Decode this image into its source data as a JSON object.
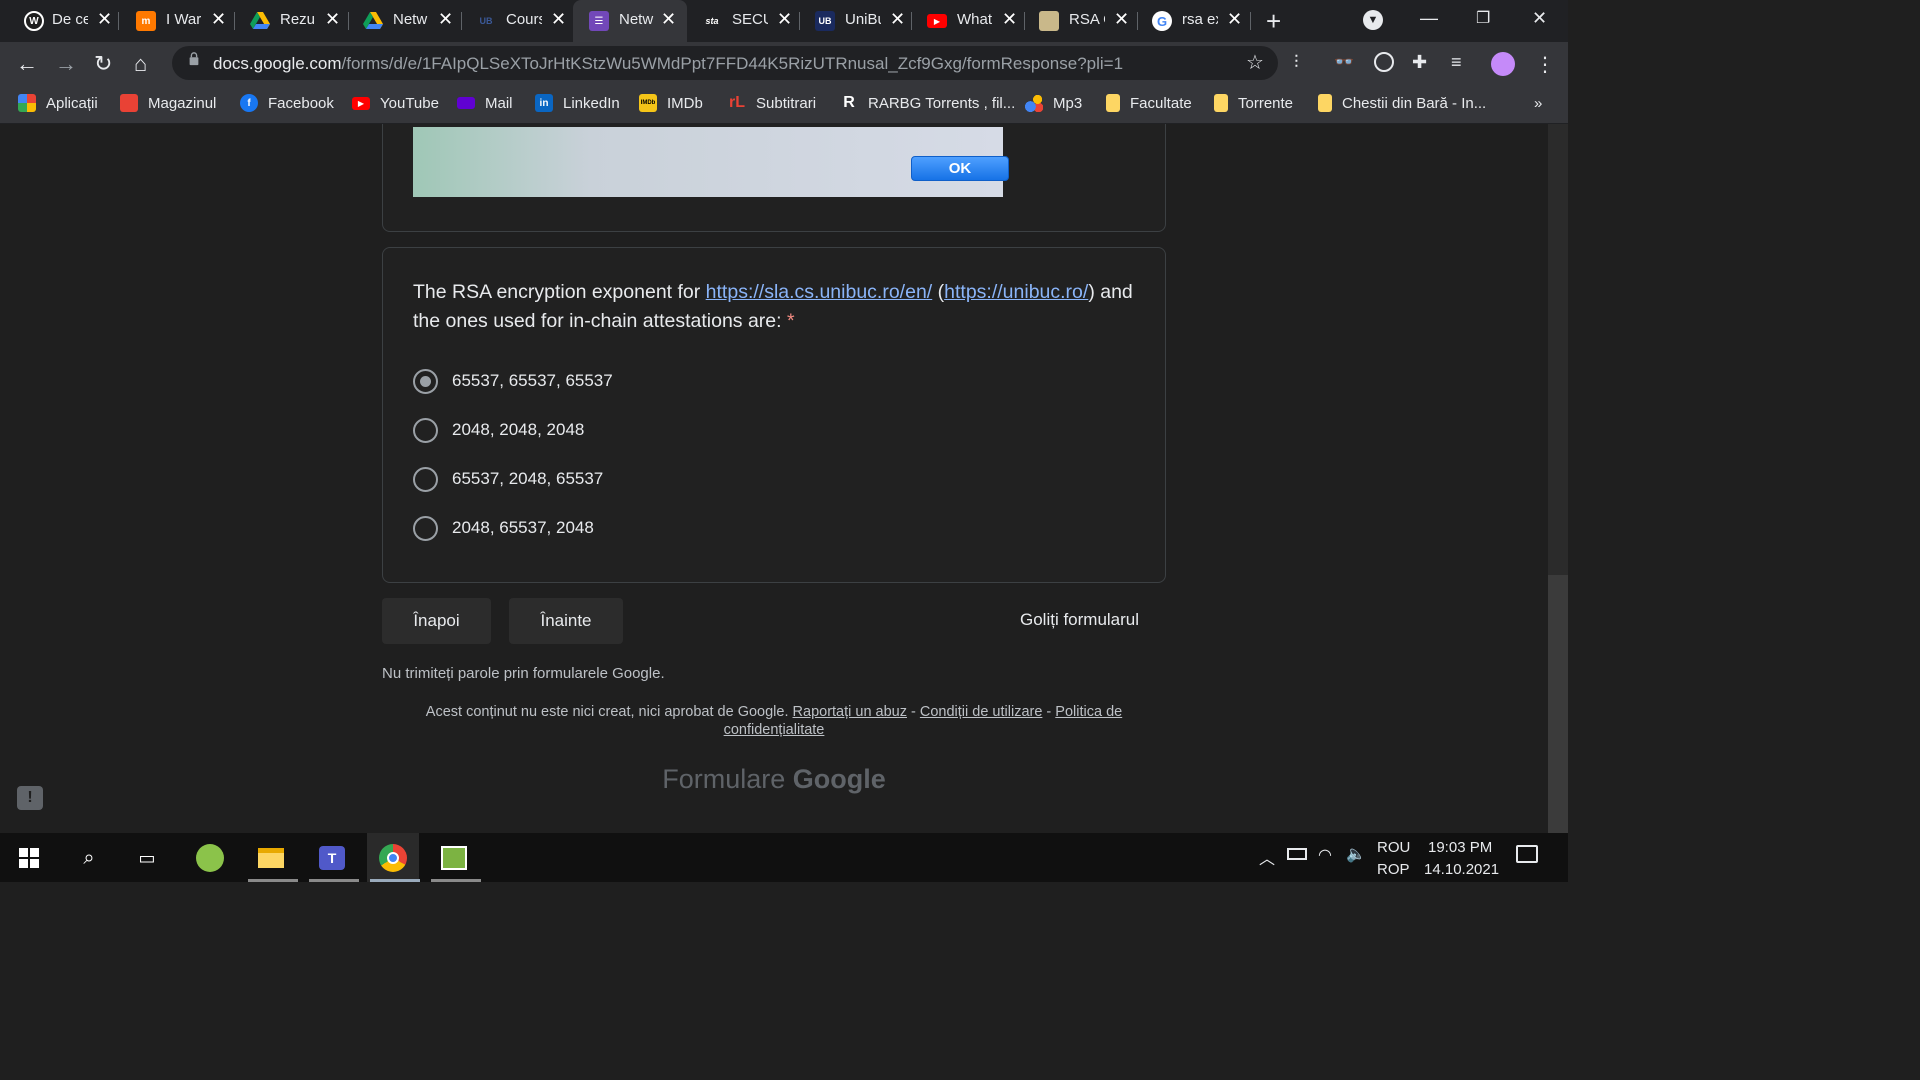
{
  "tabs": [
    {
      "title": "De ce",
      "icon": "wordpress-icon"
    },
    {
      "title": "I War",
      "icon": "orange-m-icon"
    },
    {
      "title": "Rezul",
      "icon": "google-drive-icon"
    },
    {
      "title": "Netw",
      "icon": "google-drive-icon"
    },
    {
      "title": "Cours",
      "icon": "ub-icon"
    },
    {
      "title": "Netw",
      "icon": "google-forms-icon"
    },
    {
      "title": "SECU",
      "icon": "sta-icon"
    },
    {
      "title": "UniBu",
      "icon": "ub-icon"
    },
    {
      "title": "What",
      "icon": "youtube-icon"
    },
    {
      "title": "RSA C",
      "icon": "rsa-icon"
    },
    {
      "title": "rsa ex",
      "icon": "google-icon"
    }
  ],
  "toolbar": {
    "url_host": "docs.google.com",
    "url_path": "/forms/d/e/1FAIpQLSeXToJrHtKStzWu5WMdPpt7FFD44K5RizUTRnusal_Zcf9Gxg/formResponse?pli=1"
  },
  "bookmarks": [
    {
      "label": "Aplicații",
      "icon": "apps-grid-icon",
      "color": "#e94235"
    },
    {
      "label": "Magazinul",
      "icon": "store-icon",
      "color": "#e94235"
    },
    {
      "label": "Facebook",
      "icon": "facebook-icon",
      "color": "#1877f2"
    },
    {
      "label": "YouTube",
      "icon": "youtube-icon",
      "color": "#ff0000"
    },
    {
      "label": "Mail",
      "icon": "mail-icon",
      "color": "#6001d2"
    },
    {
      "label": "LinkedIn",
      "icon": "linkedin-icon",
      "color": "#0a66c2"
    },
    {
      "label": "IMDb",
      "icon": "imdb-icon",
      "color": "#f5c518"
    },
    {
      "label": "Subtitrari",
      "icon": "subtitrari-icon",
      "color": "#e94235"
    },
    {
      "label": "RARBG Torrents , fil...",
      "icon": "rarbg-icon",
      "color": "#ffffff"
    },
    {
      "label": "Mp3",
      "icon": "mp3-icon",
      "color": "#4285f4"
    },
    {
      "label": "Facultate",
      "icon": "folder-icon",
      "color": "#fdd663"
    },
    {
      "label": "Torrente",
      "icon": "folder-icon",
      "color": "#fdd663"
    },
    {
      "label": "Chestii din Bară - In...",
      "icon": "folder-icon",
      "color": "#fdd663"
    }
  ],
  "dialog": {
    "ok_label": "OK"
  },
  "question": {
    "text_before": "The RSA encryption exponent for ",
    "link1": "https://sla.cs.unibuc.ro/en/",
    "paren_open": " (",
    "link2": "https://unibuc.ro/",
    "text_after": ") and the ones used for in-chain attestations are:",
    "required_mark": " *",
    "options": [
      {
        "label": "65537, 65537, 65537",
        "selected": true
      },
      {
        "label": "2048, 2048, 2048",
        "selected": false
      },
      {
        "label": "65537, 2048, 65537",
        "selected": false
      },
      {
        "label": "2048, 65537, 2048",
        "selected": false
      }
    ]
  },
  "form_nav": {
    "back_label": "Înapoi",
    "next_label": "Înainte",
    "clear_label": "Goliți formularul"
  },
  "footer": {
    "password_note": "Nu trimiteți parole prin formularele Google.",
    "legal_text": "Acest conținut nu este nici creat, nici aprobat de Google.",
    "report_link": "Raportați un abuz",
    "terms_link": "Condiții de utilizare",
    "privacy_link": "Politica de confidențialitate",
    "sep": " - ",
    "brand_text": "Formulare",
    "brand_google": "Google"
  },
  "taskbar": {
    "lang_top": "ROU",
    "lang_bottom": "ROP",
    "time": "19:03 PM",
    "date": "14.10.2021"
  },
  "colors": {
    "accent_link": "#8ab4f8",
    "required": "#f28b82",
    "forms_purple": "#7248b9"
  }
}
